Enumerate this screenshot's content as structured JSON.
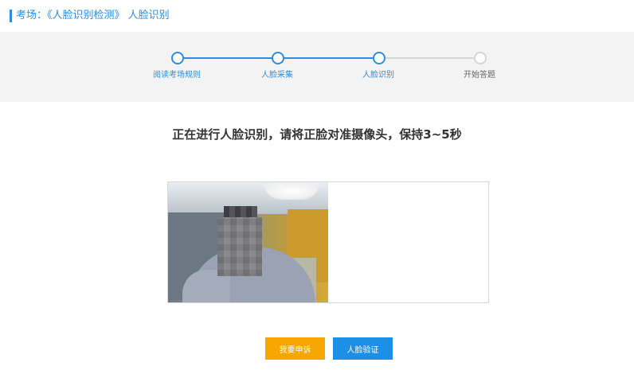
{
  "header": {
    "title": "考场：《人脸识别检测》 人脸识别"
  },
  "steps": [
    {
      "label": "阅读考场规则",
      "status": "done"
    },
    {
      "label": "人脸采集",
      "status": "done"
    },
    {
      "label": "人脸识别",
      "status": "current"
    },
    {
      "label": "开始答题",
      "status": "pending"
    }
  ],
  "main": {
    "instruction": "正在进行人脸识别，请将正脸对准摄像头，保持3~5秒"
  },
  "buttons": {
    "appeal_label": "我要申诉",
    "verify_label": "人脸验证"
  },
  "colors": {
    "accent": "#2a8ee2",
    "appeal": "#f7a600",
    "verify": "#1d8fe6",
    "pending": "#d6d6d6",
    "stepper_bg": "#f3f3f3"
  }
}
